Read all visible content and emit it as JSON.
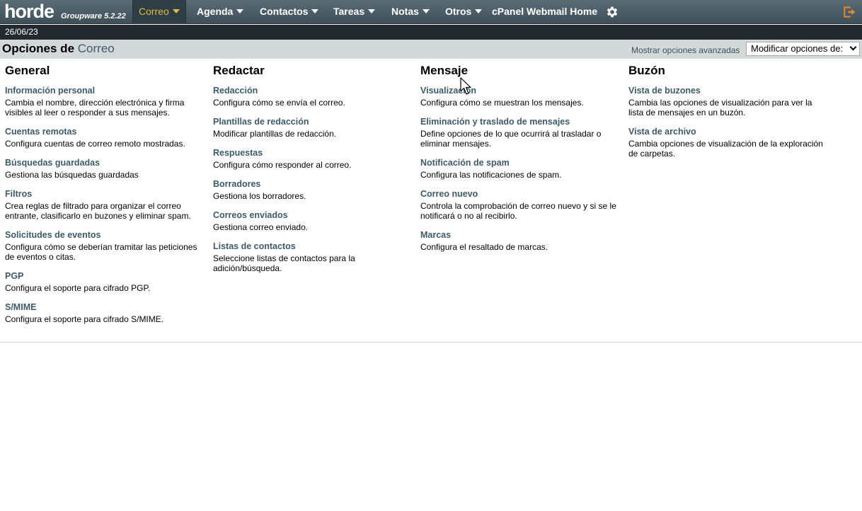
{
  "topbar": {
    "logo": "horde",
    "logo_sub": "Groupware 5.2.22",
    "nav": [
      {
        "label": "Correo"
      },
      {
        "label": "Agenda"
      },
      {
        "label": "Contactos"
      },
      {
        "label": "Tareas"
      },
      {
        "label": "Notas"
      },
      {
        "label": "Otros"
      },
      {
        "label": "cPanel Webmail Home"
      }
    ],
    "icons": {
      "settings": "gear-icon",
      "logout": "logout-icon"
    },
    "colors": {
      "bar": "#4a5d66",
      "active_text": "#e2b84a"
    }
  },
  "datebar": {
    "date": "26/06/23"
  },
  "header": {
    "title_prefix": "Opciones de",
    "title_app": "Correo",
    "advanced_link": "Mostrar opciones avanzadas",
    "select_value": "Modificar opciones de:"
  },
  "columns": [
    {
      "heading": "General",
      "items": [
        {
          "title": "Información personal",
          "desc": "Cambia el nombre, dirección electrónica y firma visibles al leer o responder a sus mensajes."
        },
        {
          "title": "Cuentas remotas",
          "desc": "Configura cuentas de correo remoto mostradas."
        },
        {
          "title": "Búsquedas guardadas",
          "desc": "Gestiona las búsquedas guardadas"
        },
        {
          "title": "Filtros",
          "desc": "Crea reglas de filtrado para organizar el correo entrante, clasificarlo en buzones y eliminar spam."
        },
        {
          "title": "Solicitudes de eventos",
          "desc": "Configura cómo se deberían tramitar las peticiones de eventos o citas."
        },
        {
          "title": "PGP",
          "desc": "Configura el soporte para cifrado PGP."
        },
        {
          "title": "S/MIME",
          "desc": "Configura el soporte para cifrado S/MIME."
        }
      ]
    },
    {
      "heading": "Redactar",
      "items": [
        {
          "title": "Redacción",
          "desc": "Configura cómo se envía el correo."
        },
        {
          "title": "Plantillas de redacción",
          "desc": "Modificar plantillas de redacción."
        },
        {
          "title": "Respuestas",
          "desc": "Configura cómo responder al correo."
        },
        {
          "title": "Borradores",
          "desc": "Gestiona los borradores."
        },
        {
          "title": "Correos enviados",
          "desc": "Gestiona correo enviado."
        },
        {
          "title": "Listas de contactos",
          "desc": "Seleccione listas de contactos para la adición/búsqueda."
        }
      ]
    },
    {
      "heading": "Mensaje",
      "items": [
        {
          "title": "Visualización",
          "desc": "Configura cómo se muestran los mensajes."
        },
        {
          "title": "Eliminación y traslado de mensajes",
          "desc": "Define opciones de lo que ocurrirá al trasladar o eliminar mensajes."
        },
        {
          "title": "Notificación de spam",
          "desc": "Configura las notificaciones de spam."
        },
        {
          "title": "Correo nuevo",
          "desc": "Controla la comprobación de correo nuevo y si se le notificará o no al recibirlo."
        },
        {
          "title": "Marcas",
          "desc": "Configura el resaltado de marcas."
        }
      ]
    },
    {
      "heading": "Buzón",
      "items": [
        {
          "title": "Vista de buzones",
          "desc": "Cambia las opciones de visualización para ver la lista de mensajes en un buzón."
        },
        {
          "title": "Vista de archivo",
          "desc": "Cambia opciones de visualización de la exploración de carpetas."
        }
      ]
    }
  ]
}
